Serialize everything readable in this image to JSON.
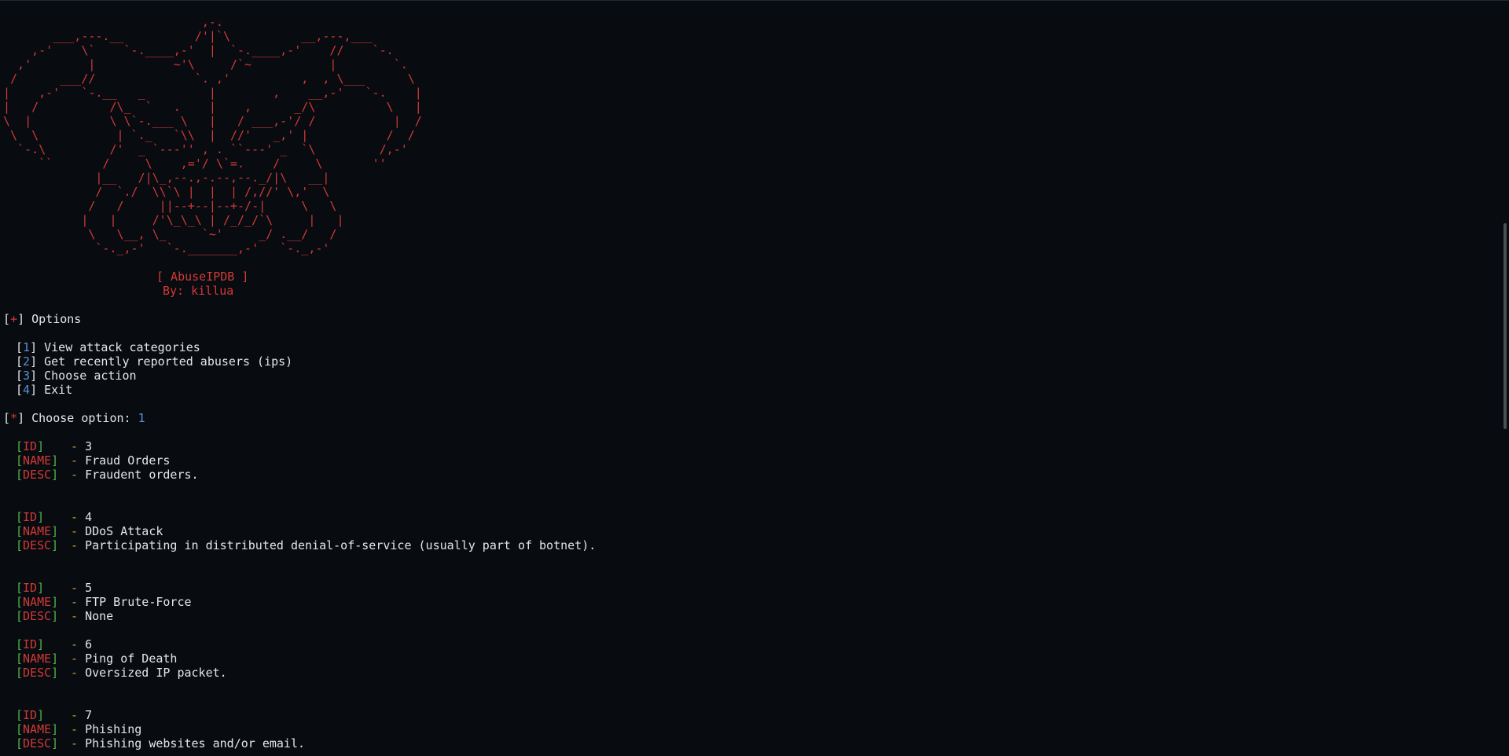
{
  "ascii_art": "                            ,-.\n       ___,---.__          /'|`\\          __,---,___\n    ,-'    \\`    `-.____,-'  |  `-.____,-'    //    `-.\n  ,'        |           ~'\\     /`~           |        `.\n /      ___//              `. ,'          ,  , \\___      \\\n|    ,-'   `-.__   _         |        ,    __,-'   `-.    |\n|   /          /\\_  `   .    |    ,      _/\\          \\   |\n\\  |           \\ \\`-.___ \\   |   / ___,-'/ /           |  /\n \\  \\           | `._   `\\\\  |  //'   _,' |           /  /\n  `-.\\         /'  _ `---'' , . ``---' _  `\\         /,-'\n     ``       /     \\    ,='/ \\`=.    /     \\       ''\n             |__   /|\\_,--.,-.--,--._/|\\   __|\n             /  `./  \\\\`\\ |  |  | /,//' \\,'  \\\n            /   /     ||--+--|--+-/-|     \\   \\\n           |   |     /'\\_\\_\\ | /_/_/`\\     |   |\n            \\   \\__, \\_     `~'     _/ .__/   /\n             `-._,-'   `-._______,-'   `-._,-'",
  "banner": {
    "title": "[ AbuseIPDB ]",
    "author": "By: killua"
  },
  "menu": {
    "header_mark": "+",
    "header_label": "Options",
    "items": [
      {
        "num": "1",
        "label": "View attack categories"
      },
      {
        "num": "2",
        "label": "Get recently reported abusers (ips)"
      },
      {
        "num": "3",
        "label": "Choose action"
      },
      {
        "num": "4",
        "label": "Exit"
      }
    ]
  },
  "prompt": {
    "mark": "*",
    "label": "Choose option:",
    "value": "1"
  },
  "labels": {
    "id": "ID",
    "name": "NAME",
    "desc": "DESC",
    "sep": "-"
  },
  "records": [
    {
      "id": "3",
      "name": "Fraud Orders",
      "desc": "Fraudent orders."
    },
    {
      "id": "4",
      "name": "DDoS Attack",
      "desc": "Participating in distributed denial-of-service (usually part of botnet)."
    },
    {
      "id": "5",
      "name": "FTP Brute-Force",
      "desc": "None"
    },
    {
      "id": "6",
      "name": "Ping of Death",
      "desc": "Oversized IP packet."
    },
    {
      "id": "7",
      "name": "Phishing",
      "desc": "Phishing websites and/or email."
    }
  ],
  "colors": {
    "background": "#080b10",
    "red": "#d13a36",
    "blue": "#5a8fd6",
    "green": "#52b64a",
    "amber": "#d49a2a",
    "text": "#e6e6e6"
  }
}
